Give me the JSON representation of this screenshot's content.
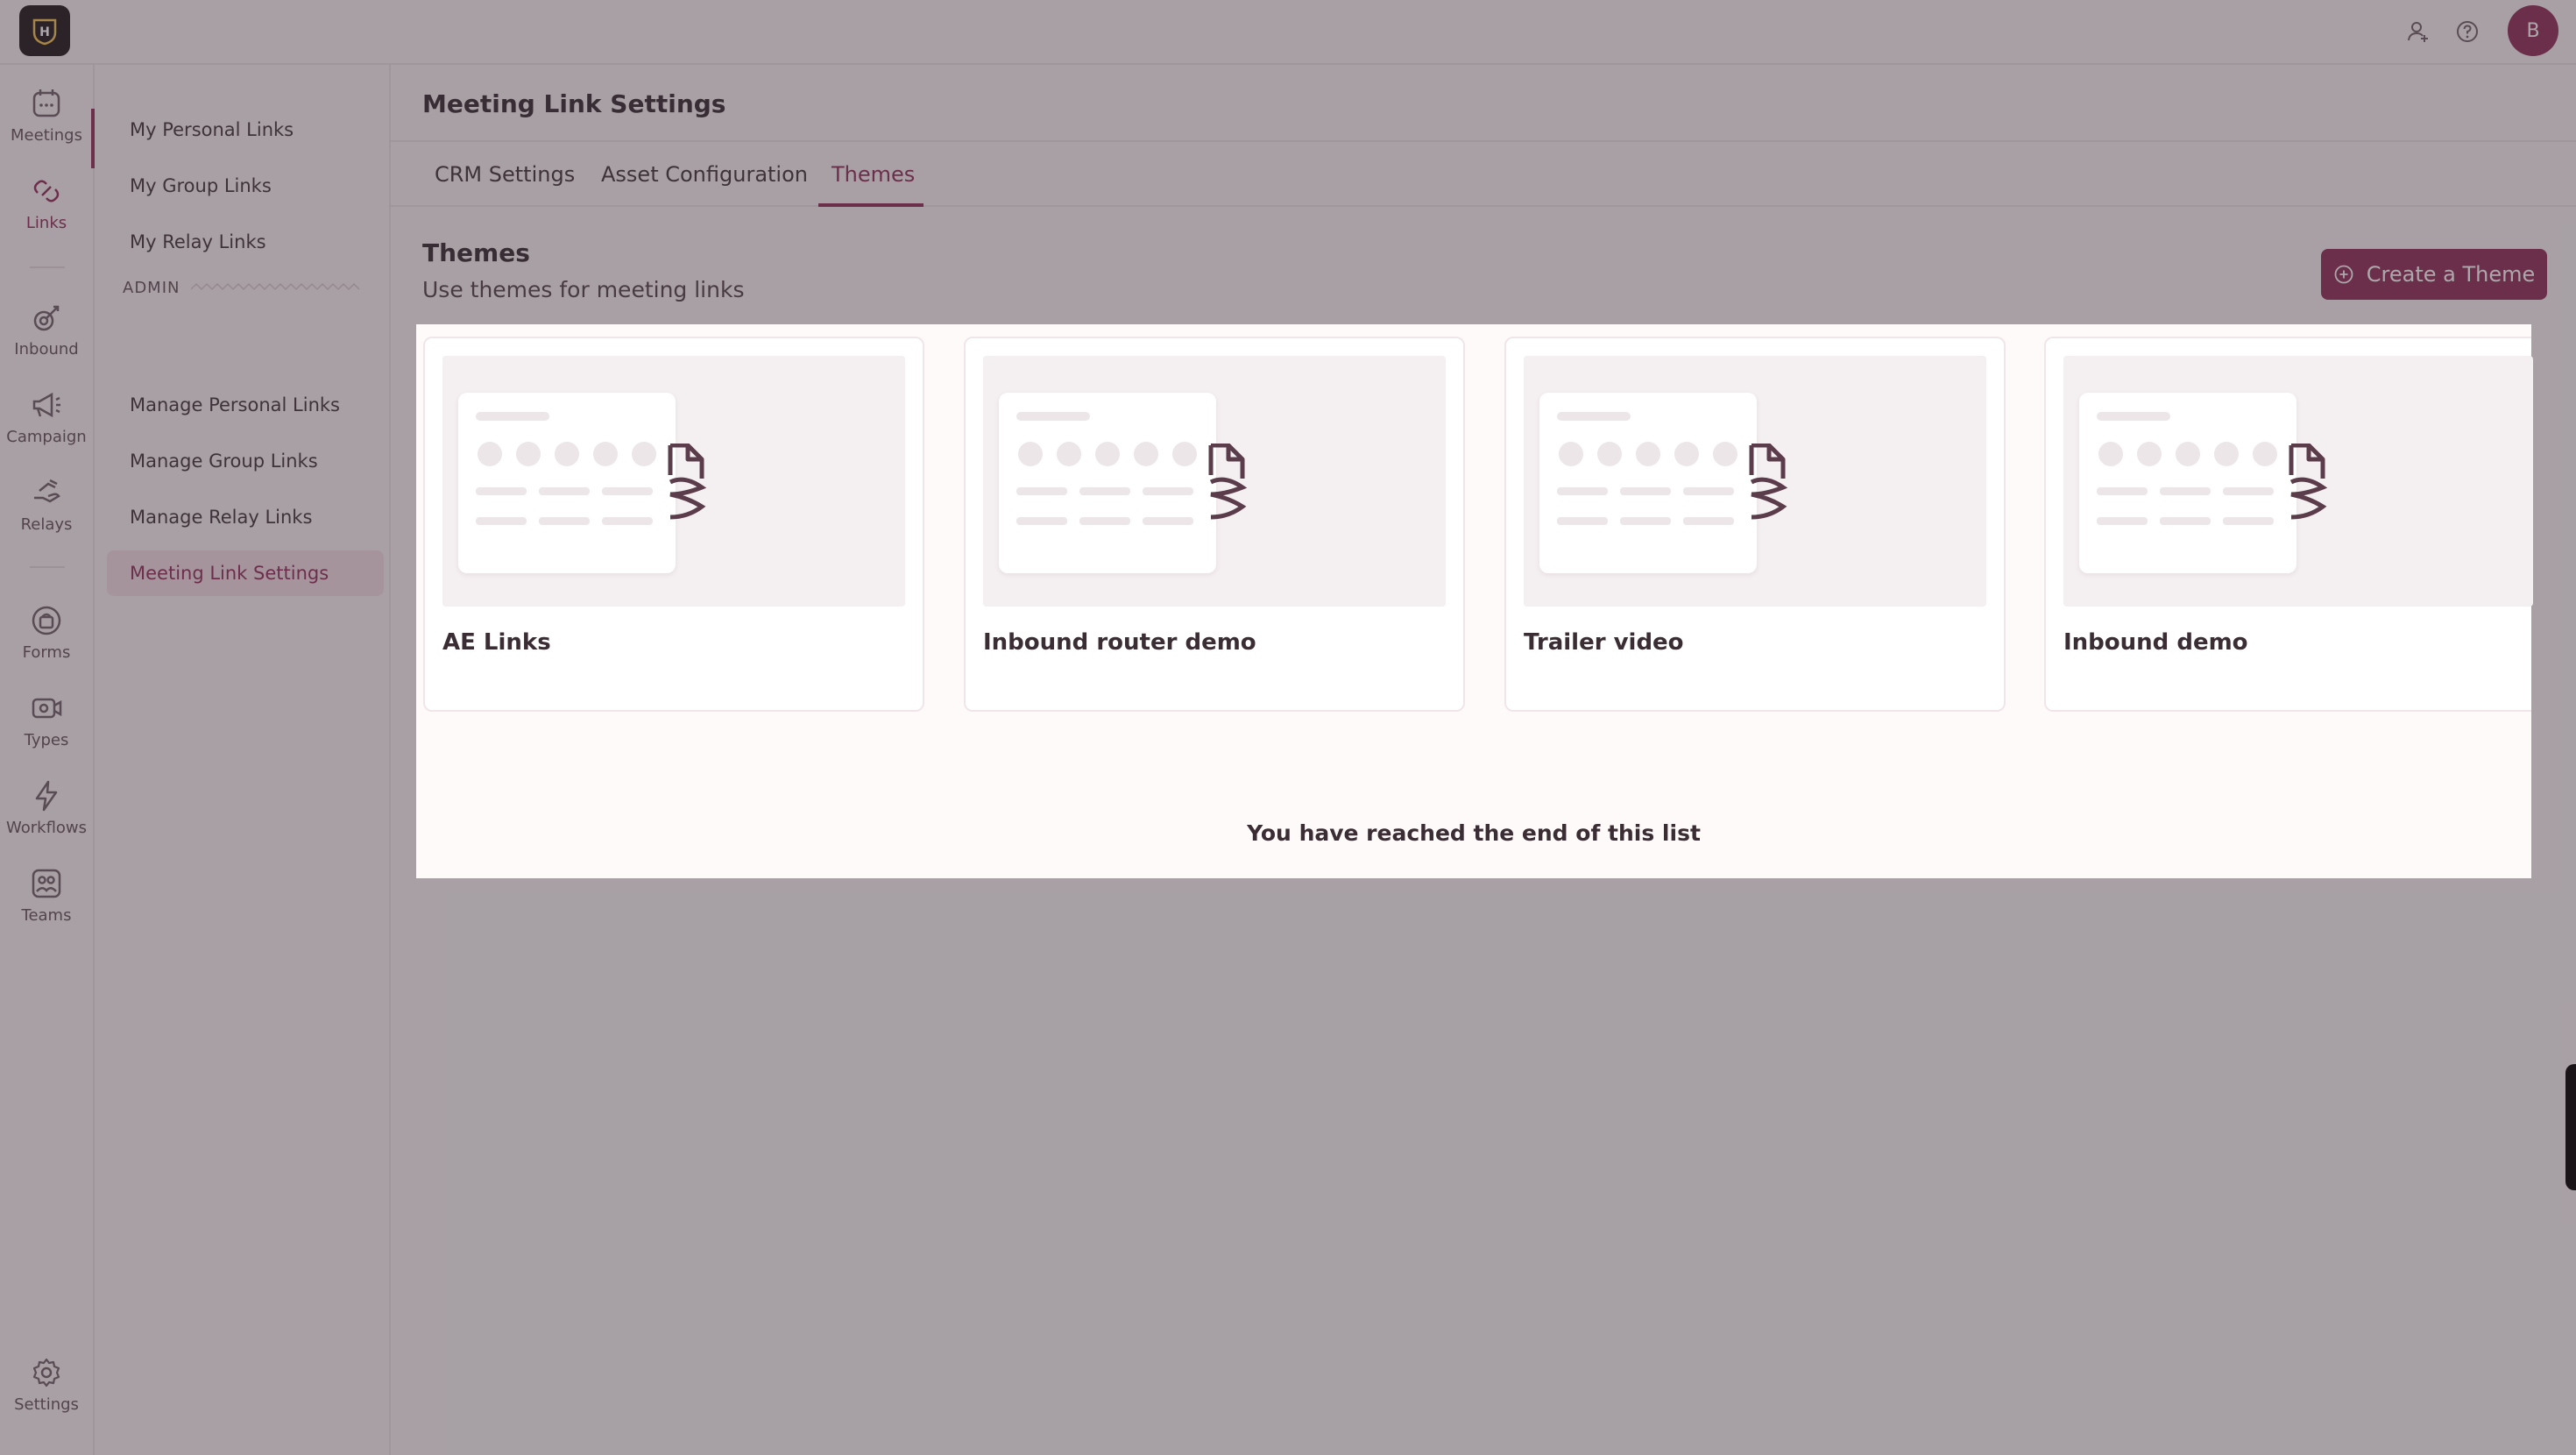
{
  "app": {
    "avatar_initial": "B",
    "accent_color": "#8b2552"
  },
  "rail": {
    "items": [
      {
        "label": "Meetings",
        "icon": "calendar-icon"
      },
      {
        "label": "Links",
        "icon": "link-icon",
        "active": true
      },
      {
        "label": "Inbound",
        "icon": "inbound-icon"
      },
      {
        "label": "Campaign",
        "icon": "megaphone-icon"
      },
      {
        "label": "Relays",
        "icon": "relay-hand-icon"
      },
      {
        "label": "Forms",
        "icon": "forms-icon"
      },
      {
        "label": "Types",
        "icon": "video-type-icon"
      },
      {
        "label": "Workflows",
        "icon": "lightning-icon"
      },
      {
        "label": "Teams",
        "icon": "teams-icon"
      },
      {
        "label": "Settings",
        "icon": "gear-icon"
      }
    ]
  },
  "subnav": {
    "items": [
      {
        "label": "My Personal Links"
      },
      {
        "label": "My Group Links"
      },
      {
        "label": "My Relay Links"
      }
    ],
    "admin_label": "ADMIN",
    "admin_items": [
      {
        "label": "Manage Personal Links"
      },
      {
        "label": "Manage Group Links"
      },
      {
        "label": "Manage Relay Links"
      },
      {
        "label": "Meeting Link Settings",
        "active": true
      }
    ]
  },
  "main": {
    "title": "Meeting Link Settings",
    "tabs": [
      {
        "label": "CRM Settings"
      },
      {
        "label": "Asset Configuration"
      },
      {
        "label": "Themes",
        "active": true
      }
    ],
    "section_title": "Themes",
    "section_subtitle": "Use themes for meeting links",
    "create_button": "Create a Theme",
    "themes": [
      {
        "name": "AE Links"
      },
      {
        "name": "Inbound router demo"
      },
      {
        "name": "Trailer video"
      },
      {
        "name": "Inbound demo"
      }
    ],
    "end_of_list": "You have reached the end of this list"
  }
}
